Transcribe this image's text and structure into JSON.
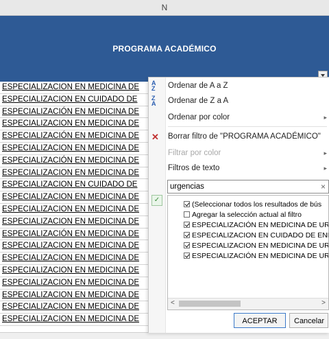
{
  "sheet": {
    "column_letter": "N",
    "header_title": "PROGRAMA ACADÉMICO",
    "rows": [
      "ESPECIALIZACION EN MEDICINA DE",
      "ESPECIALIZACION EN CUIDADO DE",
      "ESPECIALIZACIÓN EN MEDICINA DE",
      "ESPECIALIZACION EN MEDICINA DE",
      "ESPECIALIZACIÓN EN MEDICINA DE",
      "ESPECIALIZACION EN MEDICINA DE",
      "ESPECIALIZACIÓN EN MEDICINA DE",
      "ESPECIALIZACION EN MEDICINA DE",
      "ESPECIALIZACION EN CUIDADO DE",
      "ESPECIALIZACION EN MEDICINA DE",
      "ESPECIALIZACION EN MEDICINA DE",
      "ESPECIALIZACION EN MEDICINA DE",
      "ESPECIALIZACIÓN  EN MEDICINA DE",
      "ESPECIALIZACION EN MEDICINA DE",
      "ESPECIALIZACION EN MEDICINA DE",
      "ESPECIALIZACION EN MEDICINA DE",
      "ESPECIALIZACION EN MEDICINA DE",
      "ESPECIALIZACION EN MEDICINA DE",
      "ESPECIALIZACION EN MEDICINA DE",
      "ESPECIALIZACION EN MEDICINA DE"
    ]
  },
  "filter_menu": {
    "sort_az": "Ordenar de A a Z",
    "sort_za": "Ordenar de Z a A",
    "sort_by_color": "Ordenar por color",
    "clear_filter": "Borrar filtro de \"PROGRAMA ACADÉMICO\"",
    "filter_by_color": "Filtrar por color",
    "text_filters": "Filtros de texto",
    "search_value": "urgencias",
    "search_clear": "×",
    "list_items": [
      {
        "label": "(Seleccionar todos los resultados de bús",
        "checked": true
      },
      {
        "label": "Agregar la selección actual al filtro",
        "checked": false
      },
      {
        "label": "ESPECIALIZACIÓN  EN MEDICINA DE URG",
        "checked": true
      },
      {
        "label": "ESPECIALIZACION EN CUIDADO DE ENFE",
        "checked": true
      },
      {
        "label": "ESPECIALIZACION EN MEDICINA DE URG",
        "checked": true
      },
      {
        "label": "ESPECIALIZACIÓN EN MEDICINA DE URG",
        "checked": true
      }
    ],
    "ok_button": "ACEPTAR",
    "cancel_button": "Cancelar"
  },
  "icons": {
    "submenu_arrow": "▸",
    "scroll_left": "<",
    "scroll_right": ">",
    "check": "✓"
  }
}
